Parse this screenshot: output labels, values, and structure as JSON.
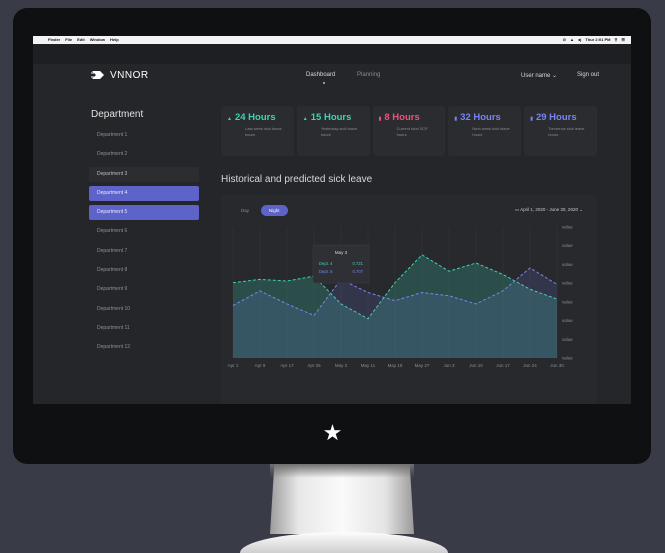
{
  "menubar": {
    "apple": "",
    "items": [
      "Finder",
      "File",
      "Edit",
      "Window",
      "Help"
    ],
    "clock": "Thur 2:01 PM"
  },
  "app": {
    "logo": "VNNOR",
    "nav": {
      "dashboard": "Dashboard",
      "planning": "Planning",
      "user": "User name",
      "signout": "Sign out"
    }
  },
  "sidebar": {
    "title": "Department",
    "items": [
      "Department 1",
      "Department 2",
      "Department 3",
      "Department 4",
      "Department 5",
      "Department 6",
      "Department 7",
      "Department 8",
      "Department 9",
      "Department 10",
      "Department 11",
      "Department 12"
    ]
  },
  "stats": [
    {
      "value": "24 Hours",
      "desc": "Last week sick leave hours",
      "color": "#3fd3b2"
    },
    {
      "value": "15 Hours",
      "desc": "Yesterday sick leave hours",
      "color": "#3fd3b2"
    },
    {
      "value": "8 Hours",
      "desc": "Current total SOF hours",
      "color": "#f0507a"
    },
    {
      "value": "32 Hours",
      "desc": "Next week sick leave hours",
      "color": "#7b83f0"
    },
    {
      "value": "29 Hours",
      "desc": "Tomorrow sick leave hours",
      "color": "#7b83f0"
    }
  ],
  "section_title": "Historical and predicted sick leave",
  "toggle": {
    "day": "Day",
    "night": "Night"
  },
  "daterange": "April 1, 2020 - June 30, 2020",
  "chart_data": {
    "type": "area",
    "x": [
      "Apr 1",
      "Apr 9",
      "Apr 17",
      "Apr 25",
      "May 3",
      "May 11",
      "May 19",
      "May 27",
      "Jun 3",
      "Jun 10",
      "Jun 17",
      "Jun 24",
      "Jun 30"
    ],
    "y_tick_labels": [
      "value",
      "value",
      "value",
      "value",
      "value",
      "value",
      "value",
      "value"
    ],
    "series": [
      {
        "name": "Dept. 4",
        "color": "#3fd3b2",
        "values": [
          46,
          48,
          47,
          50,
          33,
          24,
          46,
          63,
          53,
          58,
          51,
          42,
          36
        ]
      },
      {
        "name": "Dept. 5",
        "color": "#7b83f0",
        "values": [
          32,
          41,
          33,
          26,
          48,
          40,
          35,
          40,
          38,
          33,
          41,
          55,
          45
        ]
      }
    ],
    "tooltip": {
      "title": "May 3",
      "rows": [
        {
          "label": "Dept. 4",
          "value": "0.721"
        },
        {
          "label": "Dept. 5",
          "value": "0.707"
        }
      ]
    },
    "ylim": [
      0,
      80
    ]
  }
}
